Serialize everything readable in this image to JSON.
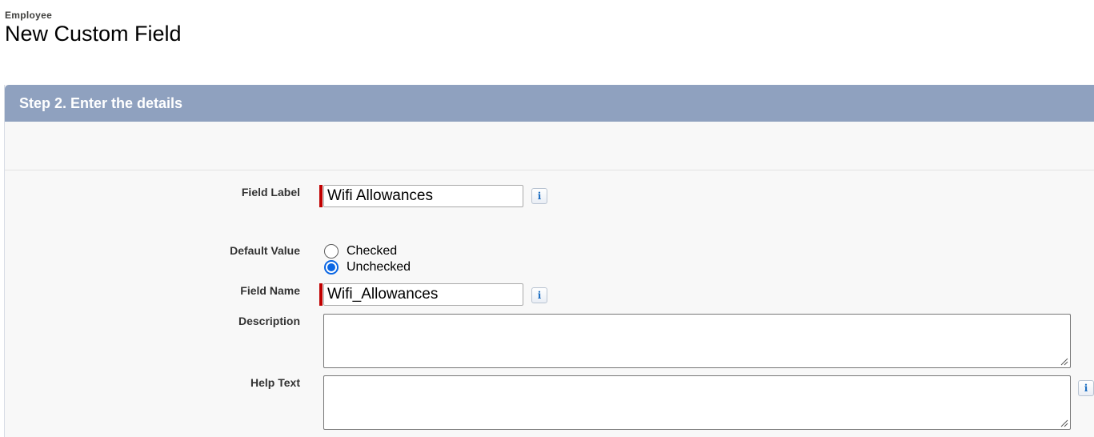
{
  "header": {
    "object_name": "Employee",
    "title": "New Custom Field"
  },
  "step": {
    "title": "Step 2. Enter the details"
  },
  "form": {
    "field_label": {
      "label": "Field Label",
      "value": "Wifi Allowances",
      "required": true
    },
    "default_value": {
      "label": "Default Value",
      "options": [
        "Checked",
        "Unchecked"
      ],
      "selected": "Unchecked"
    },
    "field_name": {
      "label": "Field Name",
      "value": "Wifi_Allowances",
      "required": true
    },
    "description": {
      "label": "Description",
      "value": ""
    },
    "help_text": {
      "label": "Help Text",
      "value": ""
    },
    "info_glyph": "i"
  },
  "colors": {
    "header_bar": "#8fa1bf",
    "required_bar": "#c00000",
    "radio_selected": "#0a66e4",
    "panel_bg": "#f8f8f8"
  },
  "icons": [
    "info-icon",
    "resize-grip-icon"
  ]
}
